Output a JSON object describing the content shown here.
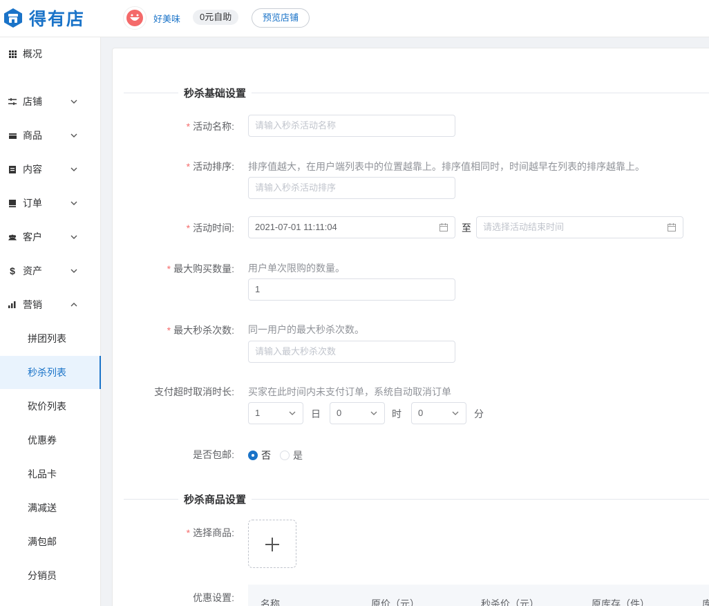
{
  "header": {
    "logo_text": "得有店",
    "store_name": "好美味",
    "store_tag": "0元自助",
    "preview_button": "预览店铺"
  },
  "sidebar": {
    "items": [
      {
        "label": "概况",
        "icon": "grid-icon"
      },
      {
        "label": "店铺",
        "icon": "store-settings-icon"
      },
      {
        "label": "商品",
        "icon": "goods-icon"
      },
      {
        "label": "内容",
        "icon": "content-icon"
      },
      {
        "label": "订单",
        "icon": "order-icon"
      },
      {
        "label": "客户",
        "icon": "customers-icon"
      },
      {
        "label": "资产",
        "icon": "dollar-icon"
      },
      {
        "label": "营销",
        "icon": "bar-chart-icon"
      }
    ],
    "marketing_sub": [
      {
        "label": "拼团列表"
      },
      {
        "label": "秒杀列表"
      },
      {
        "label": "砍价列表"
      },
      {
        "label": "优惠券"
      },
      {
        "label": "礼品卡"
      },
      {
        "label": "满减送"
      },
      {
        "label": "满包邮"
      },
      {
        "label": "分销员"
      }
    ],
    "active_sub": "秒杀列表"
  },
  "form": {
    "section_basic": "秒杀基础设置",
    "name": {
      "label": "活动名称:",
      "placeholder": "请输入秒杀活动名称"
    },
    "sort": {
      "label": "活动排序:",
      "hint": "排序值越大，在用户端列表中的位置越靠上。排序值相同时，时间越早在列表的排序越靠上。",
      "placeholder": "请输入秒杀活动排序"
    },
    "time": {
      "label": "活动时间:",
      "start_value": "2021-07-01 11:11:04",
      "separator": "至",
      "end_placeholder": "请选择活动结束时间"
    },
    "max_buy": {
      "label": "最大购买数量:",
      "hint": "用户单次限购的数量。",
      "value": "1"
    },
    "max_times": {
      "label": "最大秒杀次数:",
      "hint": "同一用户的最大秒杀次数。",
      "placeholder": "请输入最大秒杀次数"
    },
    "timeout": {
      "label": "支付超时取消时长:",
      "hint": "买家在此时间内未支付订单，系统自动取消订单",
      "day_value": "1",
      "day_unit": "日",
      "hour_value": "0",
      "hour_unit": "时",
      "minute_value": "0",
      "minute_unit": "分"
    },
    "free_shipping": {
      "label": "是否包邮:",
      "options": [
        "否",
        "是"
      ],
      "selected": "否"
    },
    "section_goods": "秒杀商品设置",
    "select_goods": {
      "label": "选择商品:"
    },
    "discount": {
      "label": "优惠设置:",
      "columns": [
        "名称",
        "原价（元）",
        "秒杀价（元）",
        "原库存（件）",
        "库"
      ]
    }
  },
  "colors": {
    "accent": "#1a73c8",
    "required": "#f56c6c"
  }
}
